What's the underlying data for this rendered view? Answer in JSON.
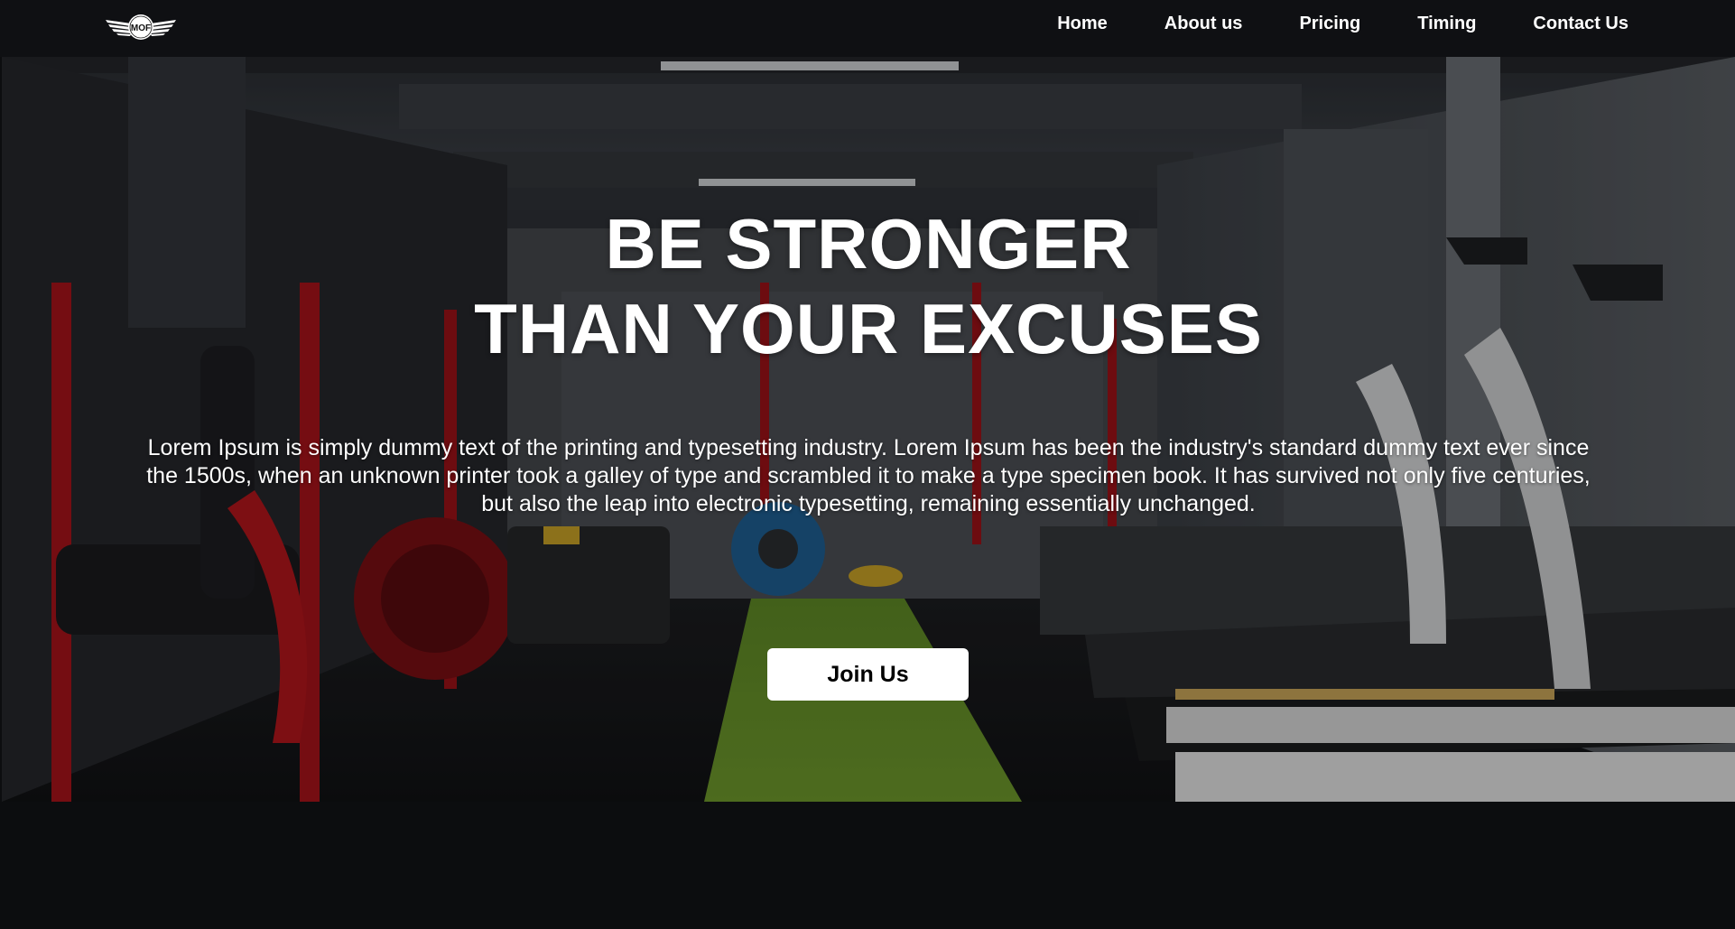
{
  "nav": {
    "logo_text": "MOF",
    "links": [
      {
        "label": "Home"
      },
      {
        "label": "About us"
      },
      {
        "label": "Pricing"
      },
      {
        "label": "Timing"
      },
      {
        "label": "Contact Us"
      }
    ]
  },
  "hero": {
    "title_line1": "BE STRONGER",
    "title_line2": "THAN YOUR EXCUSES",
    "description": "Lorem Ipsum is simply dummy text of the printing and typesetting industry. Lorem Ipsum has been the industry's standard dummy text ever since the 1500s, when an unknown printer took a galley of type and scrambled it to make a type specimen book. It has survived not only five centuries, but also the leap into electronic typesetting, remaining essentially unchanged.",
    "cta_label": "Join Us",
    "background": "gym-interior-photo"
  },
  "colors": {
    "navbar_bg": "#0f1013",
    "page_bg": "#0c0d0f",
    "button_bg": "#ffffff",
    "text": "#ffffff",
    "accent_red": "#b0141b",
    "turf_green": "#6f9a2c"
  }
}
